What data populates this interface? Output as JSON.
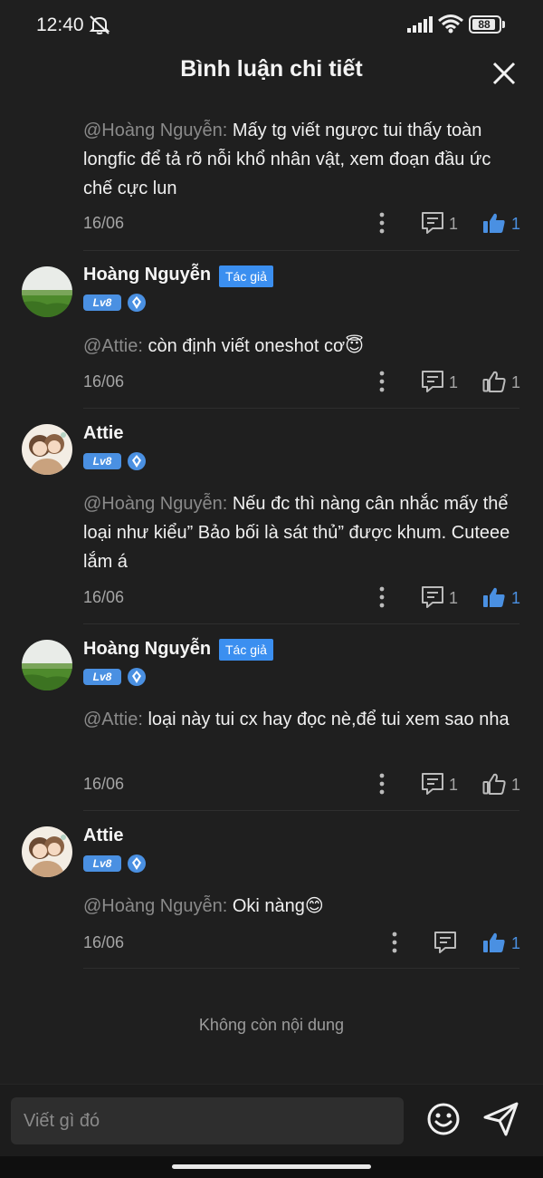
{
  "status_bar": {
    "time": "12:40",
    "battery": "88",
    "battery_level": 0.88
  },
  "header": {
    "title": "Bình luận chi tiết"
  },
  "comments": [
    {
      "author": "",
      "mention": "@Hoàng Nguyễn:",
      "text": " Mấy tg viết ngược tui thấy toàn longfic để tả rõ nỗi khổ nhân vật, xem đoạn đầu ức chế cực lun",
      "date": "16/06",
      "reply_count": "1",
      "like_count": "1",
      "liked": true
    },
    {
      "author": "Hoàng Nguyễn",
      "tag": "Tác giả",
      "level": "Lv8",
      "mention": "@Attie:",
      "text": " còn định viết oneshot cơ😇",
      "date": "16/06",
      "reply_count": "1",
      "like_count": "1",
      "liked": false
    },
    {
      "author": "Attie",
      "level": "Lv8",
      "mention": "@Hoàng Nguyễn:",
      "text": " Nếu đc thì nàng cân nhắc mấy thể loại như kiểu” Bảo bối là sát thủ” được khum. Cuteee lắm á",
      "date": "16/06",
      "reply_count": "1",
      "like_count": "1",
      "liked": true
    },
    {
      "author": "Hoàng Nguyễn",
      "tag": "Tác giả",
      "level": "Lv8",
      "mention": "@Attie:",
      "text": " loại này tui cx hay đọc nè,để tui xem sao nha",
      "date": "16/06",
      "reply_count": "1",
      "like_count": "1",
      "liked": false
    },
    {
      "author": "Attie",
      "level": "Lv8",
      "mention": "@Hoàng Nguyễn:",
      "text": " Oki nàng😊",
      "date": "16/06",
      "reply_count": "",
      "like_count": "1",
      "liked": true
    }
  ],
  "end_text": "Không còn nội dung",
  "composer": {
    "placeholder": "Viết gì đó"
  },
  "colors": {
    "accent": "#3b8ff0",
    "liked": "#4a90e2",
    "background": "#1f1f1f"
  }
}
